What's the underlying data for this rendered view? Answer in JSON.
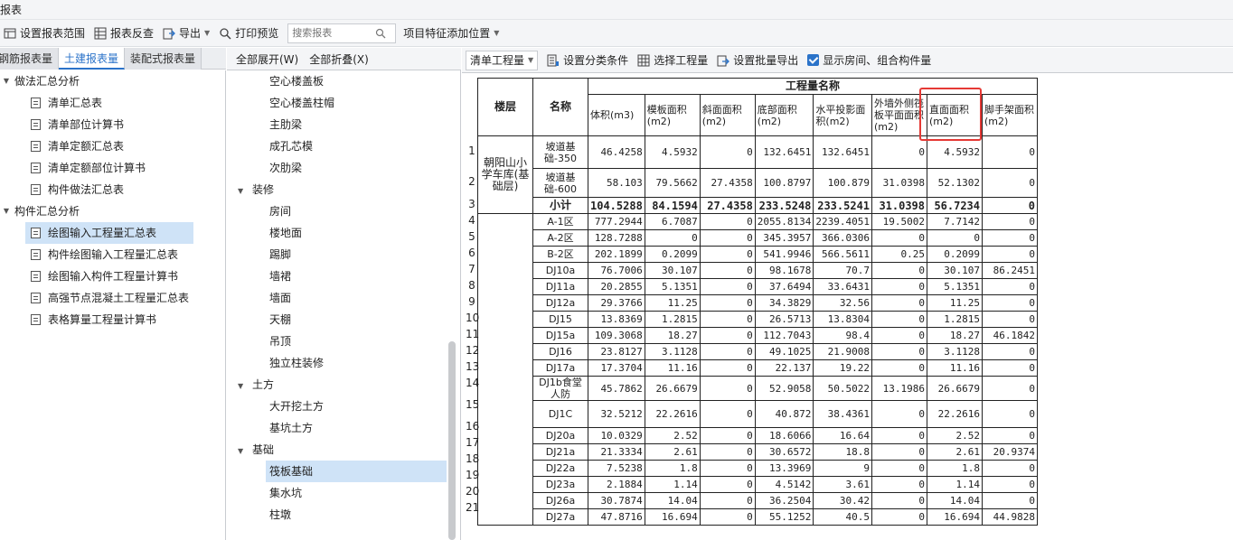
{
  "window": {
    "title": "报表"
  },
  "toolbar": {
    "set_range": "设置报表范围",
    "reverse_check": "报表反查",
    "export": "导出",
    "print_preview": "打印预览",
    "search_placeholder": "搜索报表",
    "add_position": "项目特征添加位置"
  },
  "left_tabs": [
    {
      "label": "钢筋报表量",
      "active": false
    },
    {
      "label": "土建报表量",
      "active": true
    },
    {
      "label": "装配式报表量",
      "active": false
    }
  ],
  "left_tree": {
    "group1": "做法汇总分析",
    "group1_items": [
      "清单汇总表",
      "清单部位计算书",
      "清单定额汇总表",
      "清单定额部位计算书",
      "构件做法汇总表"
    ],
    "group2": "构件汇总分析",
    "group2_items": [
      "绘图输入工程量汇总表",
      "构件绘图输入工程量汇总表",
      "绘图输入构件工程量计算书",
      "高强节点混凝土工程量汇总表",
      "表格算量工程量计算书"
    ],
    "selected": "绘图输入工程量汇总表"
  },
  "mid_head": {
    "expand_all": "全部展开(W)",
    "collapse_all": "全部折叠(X)"
  },
  "mid_tree": [
    {
      "type": "item",
      "label": "空心楼盖板"
    },
    {
      "type": "item",
      "label": "空心楼盖柱帽"
    },
    {
      "type": "item",
      "label": "主肋梁"
    },
    {
      "type": "item",
      "label": "成孔芯模"
    },
    {
      "type": "item",
      "label": "次肋梁"
    },
    {
      "type": "group",
      "label": "装修"
    },
    {
      "type": "item",
      "label": "房间"
    },
    {
      "type": "item",
      "label": "楼地面"
    },
    {
      "type": "item",
      "label": "踢脚"
    },
    {
      "type": "item",
      "label": "墙裙"
    },
    {
      "type": "item",
      "label": "墙面"
    },
    {
      "type": "item",
      "label": "天棚"
    },
    {
      "type": "item",
      "label": "吊顶"
    },
    {
      "type": "item",
      "label": "独立柱装修"
    },
    {
      "type": "group",
      "label": "土方"
    },
    {
      "type": "item",
      "label": "大开挖土方"
    },
    {
      "type": "item",
      "label": "基坑土方"
    },
    {
      "type": "group",
      "label": "基础"
    },
    {
      "type": "item",
      "label": "筏板基础",
      "selected": true
    },
    {
      "type": "item",
      "label": "集水坑"
    },
    {
      "type": "item",
      "label": "柱墩"
    }
  ],
  "right_toolbar": {
    "mode": "清单工程量",
    "set_category": "设置分类条件",
    "select_qty": "选择工程量",
    "batch_export": "设置批量导出",
    "show_rooms": "显示房间、组合构件量"
  },
  "table": {
    "header_floor": "楼层",
    "header_name": "名称",
    "header_group": "工程量名称",
    "columns": [
      "体积(m3)",
      "模板面积(m2)",
      "斜面面积(m2)",
      "底部面积(m2)",
      "水平投影面积(m2)",
      "外墙外侧筏板平面面积(m2)",
      "直面面积(m2)",
      "脚手架面积(m2)"
    ],
    "floor_name": "朝阳山小学车库(基础层)",
    "subtotal_label": "小计",
    "rows": [
      {
        "n": "1",
        "name": "坡道基础-350",
        "v": [
          "46.4258",
          "4.5932",
          "0",
          "132.6451",
          "132.6451",
          "0",
          "4.5932",
          "0"
        ]
      },
      {
        "n": "2",
        "name": "坡道基础-600",
        "v": [
          "58.103",
          "79.5662",
          "27.4358",
          "100.8797",
          "100.879",
          "31.0398",
          "52.1302",
          "0"
        ]
      },
      {
        "n": "3",
        "name": "小计",
        "v": [
          "104.5288",
          "84.1594",
          "27.4358",
          "233.5248",
          "233.5241",
          "31.0398",
          "56.7234",
          "0"
        ]
      },
      {
        "n": "4",
        "name": "A-1区",
        "v": [
          "777.2944",
          "6.7087",
          "0",
          "2055.8134",
          "2239.4051",
          "19.5002",
          "7.7142",
          "0"
        ]
      },
      {
        "n": "5",
        "name": "A-2区",
        "v": [
          "128.7288",
          "0",
          "0",
          "345.3957",
          "366.0306",
          "0",
          "0",
          "0"
        ]
      },
      {
        "n": "6",
        "name": "B-2区",
        "v": [
          "202.1899",
          "0.2099",
          "0",
          "541.9946",
          "566.5611",
          "0.25",
          "0.2099",
          "0"
        ]
      },
      {
        "n": "7",
        "name": "DJ10a",
        "v": [
          "76.7006",
          "30.107",
          "0",
          "98.1678",
          "70.7",
          "0",
          "30.107",
          "86.2451"
        ]
      },
      {
        "n": "8",
        "name": "DJ11a",
        "v": [
          "20.2855",
          "5.1351",
          "0",
          "37.6494",
          "33.6431",
          "0",
          "5.1351",
          "0"
        ]
      },
      {
        "n": "9",
        "name": "DJ12a",
        "v": [
          "29.3766",
          "11.25",
          "0",
          "34.3829",
          "32.56",
          "0",
          "11.25",
          "0"
        ]
      },
      {
        "n": "10",
        "name": "DJ15",
        "v": [
          "13.8369",
          "1.2815",
          "0",
          "26.5713",
          "13.8304",
          "0",
          "1.2815",
          "0"
        ]
      },
      {
        "n": "11",
        "name": "DJ15a",
        "v": [
          "109.3068",
          "18.27",
          "0",
          "112.7043",
          "98.4",
          "0",
          "18.27",
          "46.1842"
        ]
      },
      {
        "n": "12",
        "name": "DJ16",
        "v": [
          "23.8127",
          "3.1128",
          "0",
          "49.1025",
          "21.9008",
          "0",
          "3.1128",
          "0"
        ]
      },
      {
        "n": "13",
        "name": "DJ17a",
        "v": [
          "17.3704",
          "11.16",
          "0",
          "22.137",
          "19.22",
          "0",
          "11.16",
          "0"
        ]
      },
      {
        "n": "14",
        "name": "DJ1b食堂人防",
        "v": [
          "45.7862",
          "26.6679",
          "0",
          "52.9058",
          "50.5022",
          "13.1986",
          "26.6679",
          "0"
        ]
      },
      {
        "n": "15",
        "name": "DJ1C",
        "v": [
          "32.5212",
          "22.2616",
          "0",
          "40.872",
          "38.4361",
          "0",
          "22.2616",
          "0"
        ]
      },
      {
        "n": "16",
        "name": "DJ20a",
        "v": [
          "10.0329",
          "2.52",
          "0",
          "18.6066",
          "16.64",
          "0",
          "2.52",
          "0"
        ]
      },
      {
        "n": "17",
        "name": "DJ21a",
        "v": [
          "21.3334",
          "2.61",
          "0",
          "30.6572",
          "18.8",
          "0",
          "2.61",
          "20.9374"
        ]
      },
      {
        "n": "18",
        "name": "DJ22a",
        "v": [
          "7.5238",
          "1.8",
          "0",
          "13.3969",
          "9",
          "0",
          "1.8",
          "0"
        ]
      },
      {
        "n": "19",
        "name": "DJ23a",
        "v": [
          "2.1884",
          "1.14",
          "0",
          "4.5142",
          "3.61",
          "0",
          "1.14",
          "0"
        ]
      },
      {
        "n": "20",
        "name": "DJ26a",
        "v": [
          "30.7874",
          "14.04",
          "0",
          "36.2504",
          "30.42",
          "0",
          "14.04",
          "0"
        ]
      },
      {
        "n": "21",
        "name": "DJ27a",
        "v": [
          "47.8716",
          "16.694",
          "0",
          "55.1252",
          "40.5",
          "0",
          "16.694",
          "44.9828"
        ]
      }
    ]
  }
}
